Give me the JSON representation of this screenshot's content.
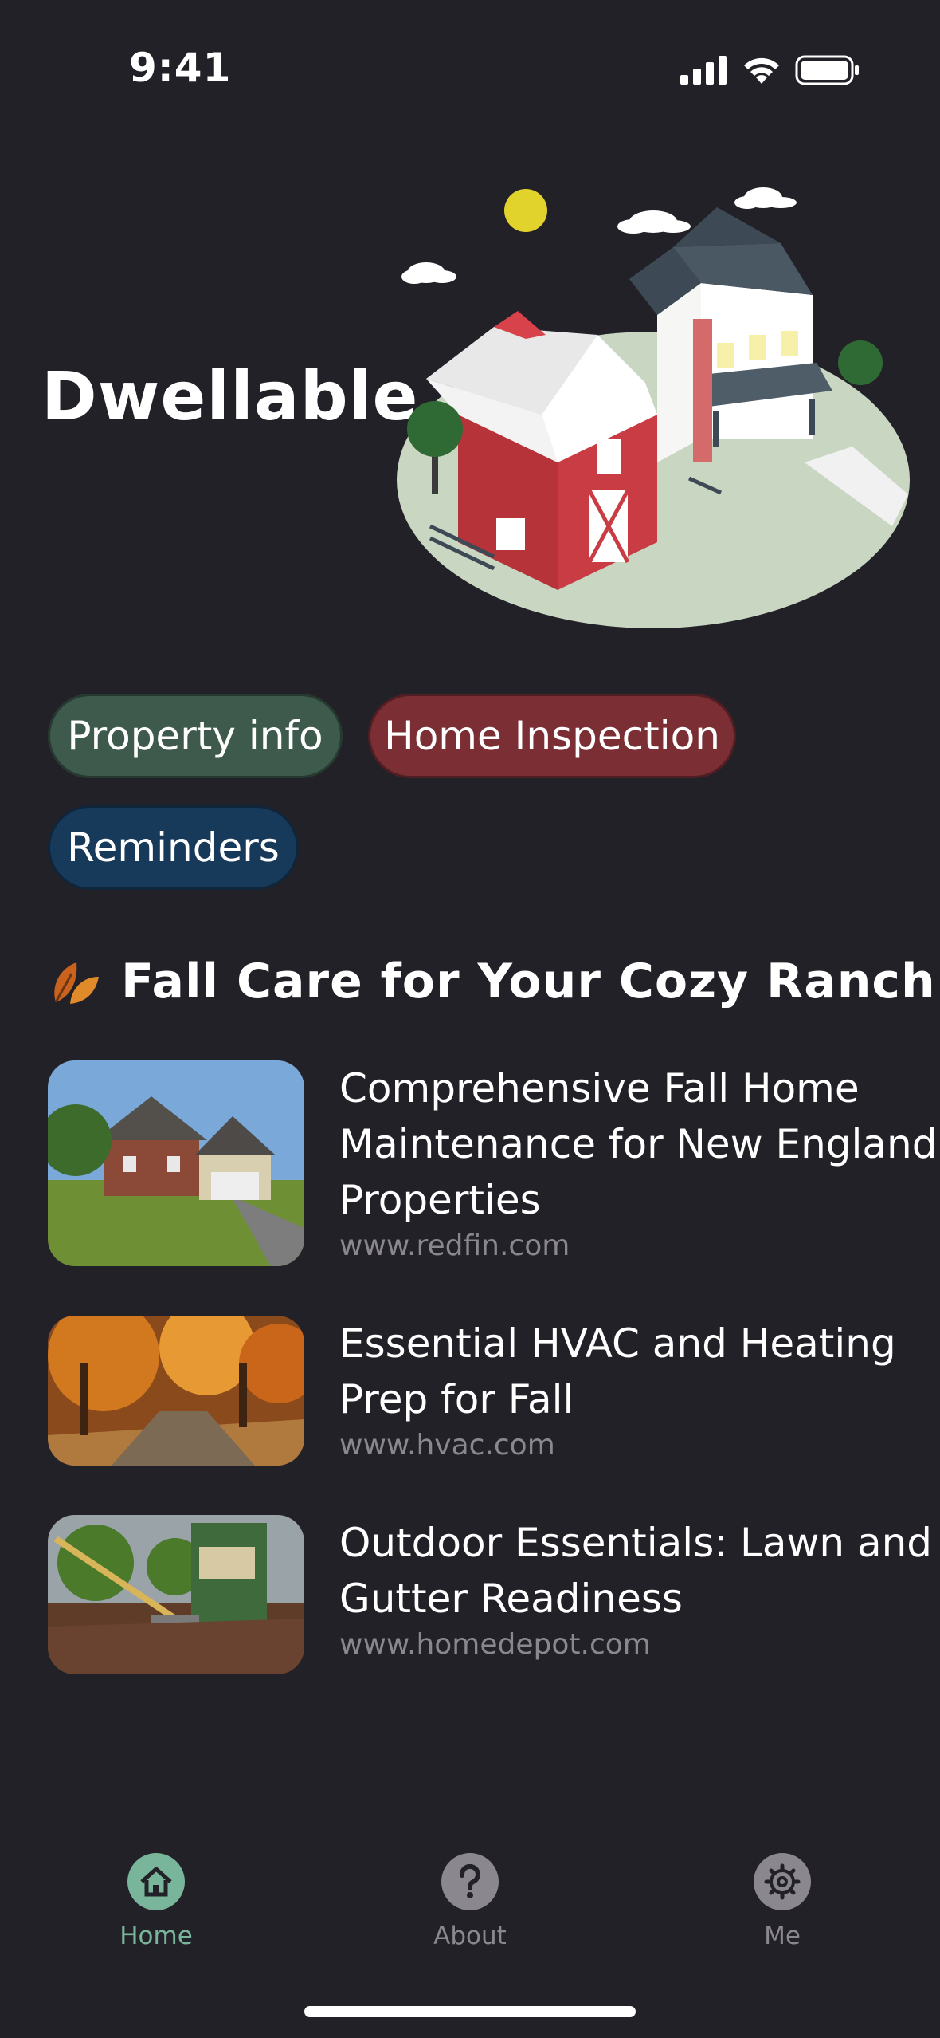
{
  "status_bar": {
    "time": "9:41"
  },
  "app": {
    "title": "Dwellable"
  },
  "chips": [
    {
      "label": "Property info",
      "color": "#3d5a4c"
    },
    {
      "label": "Home Inspection",
      "color": "#7b2f35"
    },
    {
      "label": "Reminders",
      "color": "#17395a"
    }
  ],
  "section": {
    "icon": "autumn-leaves-icon",
    "title": "Fall Care for Your Cozy Ranch"
  },
  "articles": [
    {
      "title": "Comprehensive Fall Home Maintenance for New England Properties",
      "source": "www.redfin.com"
    },
    {
      "title": "Essential HVAC and Heating Prep for Fall",
      "source": "www.hvac.com"
    },
    {
      "title": "Outdoor Essentials: Lawn and Gutter Readiness",
      "source": "www.homedepot.com"
    }
  ],
  "tab_bar": {
    "active_color": "#79b59b",
    "inactive_color": "#8a888e",
    "tabs": [
      {
        "label": "Home",
        "icon": "home-icon",
        "active": true
      },
      {
        "label": "About",
        "icon": "question-icon",
        "active": false
      },
      {
        "label": "Me",
        "icon": "gear-icon",
        "active": false
      }
    ]
  }
}
